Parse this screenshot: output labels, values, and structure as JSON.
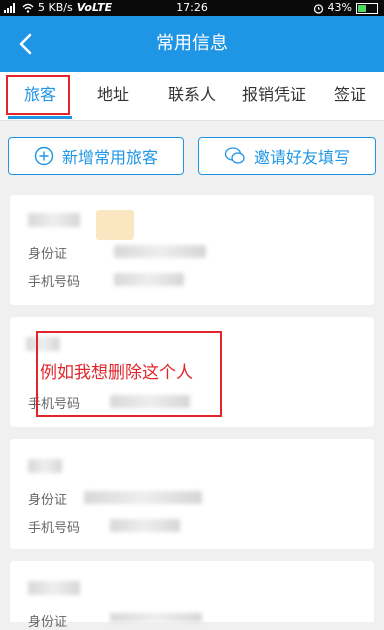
{
  "status_bar": {
    "network": "5 KB/s",
    "volte": "VoLTE",
    "time": "17:26",
    "battery": "43%"
  },
  "navbar": {
    "title": "常用信息",
    "back_icon": "chevron-left-icon"
  },
  "tabs": [
    {
      "label": "旅客",
      "active": true
    },
    {
      "label": "地址",
      "active": false
    },
    {
      "label": "联系人",
      "active": false
    },
    {
      "label": "报销凭证",
      "active": false
    },
    {
      "label": "签证",
      "active": false
    }
  ],
  "actions": {
    "add_traveler": "新增常用旅客",
    "invite_friend": "邀请好友填写"
  },
  "travelers": [
    {
      "id_label": "身份证",
      "phone_label": "手机号码"
    },
    {
      "id_label": "身份证",
      "phone_label": "手机号码"
    },
    {
      "id_label": "身份证",
      "phone_label": "手机号码"
    },
    {
      "id_label": "身份证"
    }
  ],
  "annotation": {
    "text": "例如我想删除这个人"
  },
  "colors": {
    "accent": "#1f95e6",
    "annotation": "#e0262a",
    "background": "#f0f0f0"
  }
}
